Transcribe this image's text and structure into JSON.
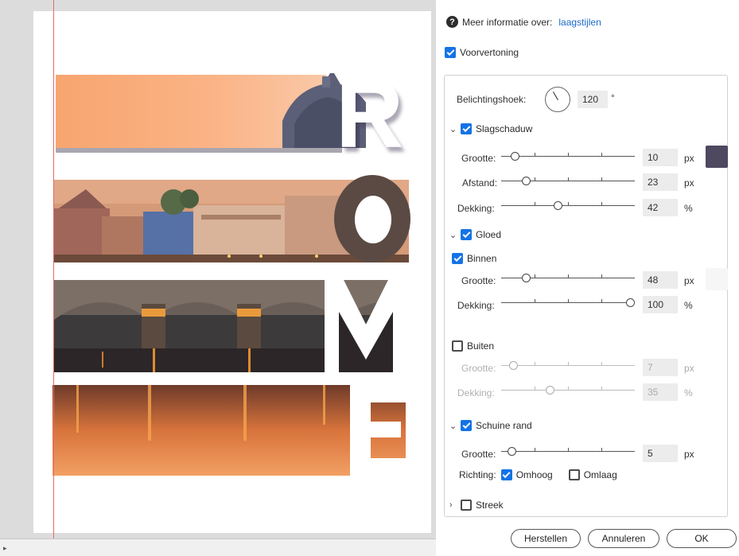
{
  "panel": {
    "info_label": "Meer informatie over:",
    "info_link": "laagstijlen",
    "preview_label": "Voorvertoning",
    "angle_label": "Belichtingshoek:",
    "angle_value": "120",
    "angle_unit": "°",
    "drop_shadow": {
      "title": "Slagschaduw",
      "size_label": "Grootte:",
      "size_value": "10",
      "size_unit": "px",
      "distance_label": "Afstand:",
      "distance_value": "23",
      "distance_unit": "px",
      "opacity_label": "Dekking:",
      "opacity_value": "42",
      "opacity_unit": "%",
      "color": "#4e4860"
    },
    "glow": {
      "title": "Gloed",
      "inner_label": "Binnen",
      "inner_size_label": "Grootte:",
      "inner_size_value": "48",
      "inner_size_unit": "px",
      "inner_opacity_label": "Dekking:",
      "inner_opacity_value": "100",
      "inner_opacity_unit": "%",
      "inner_color": "#f6f6f6",
      "outer_label": "Buiten",
      "outer_size_label": "Grootte:",
      "outer_size_value": "7",
      "outer_size_unit": "px",
      "outer_opacity_label": "Dekking:",
      "outer_opacity_value": "35",
      "outer_opacity_unit": "%"
    },
    "bevel": {
      "title": "Schuine rand",
      "size_label": "Grootte:",
      "size_value": "5",
      "size_unit": "px",
      "direction_label": "Richting:",
      "up_label": "Omhoog",
      "down_label": "Omlaag"
    },
    "stroke": {
      "title": "Streek"
    },
    "buttons": {
      "reset": "Herstellen",
      "cancel": "Annuleren",
      "ok": "OK"
    }
  },
  "artwork": {
    "letters": [
      "R",
      "O",
      "M",
      "E"
    ]
  }
}
